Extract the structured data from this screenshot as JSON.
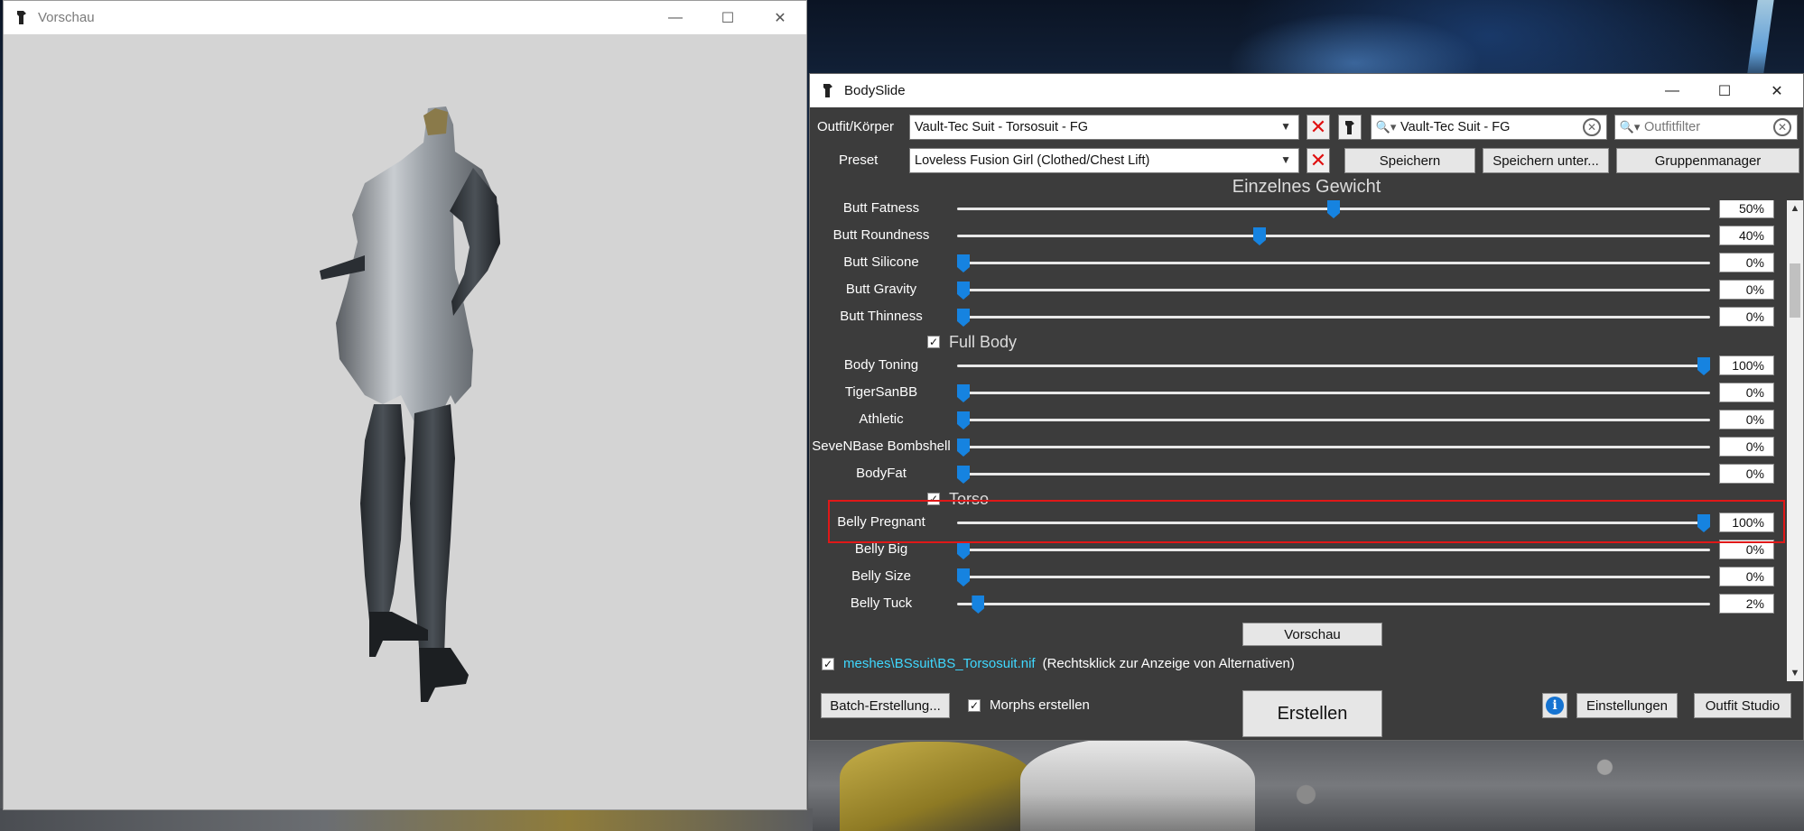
{
  "preview_window": {
    "title": "Vorschau",
    "controls": {
      "minimize": "—",
      "maximize": "☐",
      "close": "✕"
    }
  },
  "bodyslide": {
    "title": "BodySlide",
    "controls": {
      "minimize": "—",
      "maximize": "☐",
      "close": "✕"
    },
    "outfit_label": "Outfit/Körper",
    "outfit_value": "Vault-Tec Suit - Torsosuit - FG",
    "preset_label": "Preset",
    "preset_value": "Loveless Fusion Girl (Clothed/Chest Lift)",
    "group_search": "Vault-Tec Suit - FG",
    "outfit_filter_placeholder": "Outfitfilter",
    "save": "Speichern",
    "save_as": "Speichern unter...",
    "group_manager": "Gruppenmanager",
    "section_title": "Einzelnes Gewicht",
    "sliders_butt": [
      {
        "name": "Butt Fatness",
        "value": "50%",
        "level": 0.5
      },
      {
        "name": "Butt Roundness",
        "value": "40%",
        "level": 0.4
      },
      {
        "name": "Butt Silicone",
        "value": "0%",
        "level": 0
      },
      {
        "name": "Butt Gravity",
        "value": "0%",
        "level": 0
      },
      {
        "name": "Butt Thinness",
        "value": "0%",
        "level": 0
      }
    ],
    "group_full_body": "Full Body",
    "sliders_full_body": [
      {
        "name": "Body Toning",
        "value": "100%",
        "level": 1
      },
      {
        "name": "TigerSanBB",
        "value": "0%",
        "level": 0
      },
      {
        "name": "Athletic",
        "value": "0%",
        "level": 0
      },
      {
        "name": "SeveNBase Bombshell",
        "value": "0%",
        "level": 0
      },
      {
        "name": "BodyFat",
        "value": "0%",
        "level": 0
      }
    ],
    "group_torso": "Torso",
    "sliders_torso": [
      {
        "name": "Belly Pregnant",
        "value": "100%",
        "level": 1
      },
      {
        "name": "Belly Big",
        "value": "0%",
        "level": 0
      },
      {
        "name": "Belly Size",
        "value": "0%",
        "level": 0
      },
      {
        "name": "Belly Tuck",
        "value": "2%",
        "level": 0.02
      }
    ],
    "preview_button": "Vorschau",
    "nif_path": "meshes\\BSsuit\\BS_Torsosuit.nif",
    "nif_hint": "(Rechtsklick zur Anzeige von Alternativen)",
    "batch_button": "Batch-Erstellung...",
    "morphs_label": "Morphs erstellen",
    "build_button": "Erstellen",
    "settings_button": "Einstellungen",
    "outfit_studio_button": "Outfit Studio"
  },
  "colors": {
    "accent": "#1683e0",
    "link": "#3fd8ff",
    "highlight": "#e01818",
    "panel": "#3c3c3c"
  }
}
